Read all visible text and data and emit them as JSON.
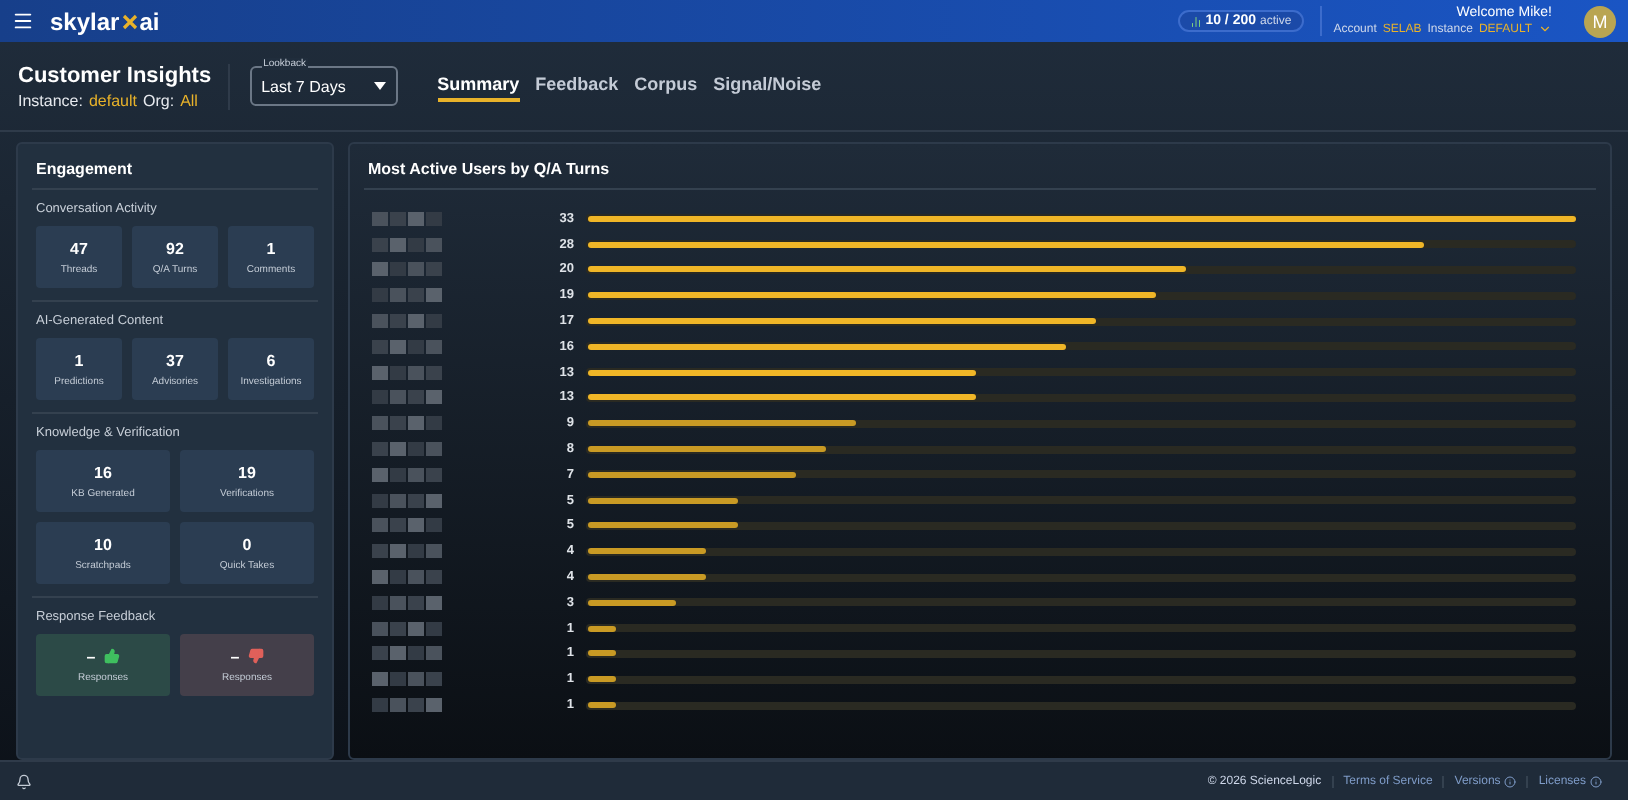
{
  "header": {
    "logo": "skylar",
    "logo_suffix": "ai",
    "usage": "10 / 200",
    "usage_label": "active",
    "welcome": "Welcome Mike!",
    "account_label": "Account",
    "account": "SELAB",
    "instance_label": "Instance",
    "instance": "DEFAULT",
    "avatar": "M"
  },
  "page": {
    "title": "Customer Insights",
    "instance_label": "Instance:",
    "instance": "default",
    "org_label": "Org:",
    "org": "All",
    "lookback_label": "Lookback",
    "lookback": "Last 7 Days",
    "tabs": [
      {
        "label": "Summary",
        "selected": true
      },
      {
        "label": "Feedback",
        "selected": false
      },
      {
        "label": "Corpus",
        "selected": false
      },
      {
        "label": "Signal/Noise",
        "selected": false
      }
    ]
  },
  "engagement": {
    "title": "Engagement",
    "sections": [
      {
        "title": "Conversation Activity",
        "stats": [
          {
            "value": "47",
            "label": "Threads"
          },
          {
            "value": "92",
            "label": "Q/A Turns"
          },
          {
            "value": "1",
            "label": "Comments"
          }
        ]
      },
      {
        "title": "AI-Generated Content",
        "stats": [
          {
            "value": "1",
            "label": "Predictions"
          },
          {
            "value": "37",
            "label": "Advisories"
          },
          {
            "value": "6",
            "label": "Investigations"
          }
        ]
      },
      {
        "title": "Knowledge & Verification",
        "stats": [
          {
            "value": "16",
            "label": "KB Generated"
          },
          {
            "value": "19",
            "label": "Verifications"
          },
          {
            "value": "10",
            "label": "Scratchpads"
          },
          {
            "value": "0",
            "label": "Quick Takes"
          }
        ]
      },
      {
        "title": "Response Feedback",
        "stats": [
          {
            "kind": "positive",
            "value": "–",
            "label": "Responses"
          },
          {
            "kind": "negative",
            "value": "–",
            "label": "Responses"
          }
        ]
      }
    ]
  },
  "chart_panel": {
    "title": "Most Active Users by Q/A Turns",
    "rows": [
      {
        "count": "33",
        "level": 1.0
      },
      {
        "count": "28",
        "level": 0.848
      },
      {
        "count": "20",
        "level": 0.606
      },
      {
        "count": "19",
        "level": 0.576
      },
      {
        "count": "17",
        "level": 0.515
      },
      {
        "count": "16",
        "level": 0.485
      },
      {
        "count": "13",
        "level": 0.394
      },
      {
        "count": "13",
        "level": 0.394
      },
      {
        "count": "9",
        "level": 0.273
      },
      {
        "count": "8",
        "level": 0.242
      },
      {
        "count": "7",
        "level": 0.212
      },
      {
        "count": "5",
        "level": 0.152
      },
      {
        "count": "5",
        "level": 0.152
      },
      {
        "count": "4",
        "level": 0.121
      },
      {
        "count": "4",
        "level": 0.121
      },
      {
        "count": "3",
        "level": 0.091
      },
      {
        "count": "1",
        "level": 0.03
      },
      {
        "count": "1",
        "level": 0.03
      },
      {
        "count": "1",
        "level": 0.03
      },
      {
        "count": "1",
        "level": 0.03
      }
    ]
  },
  "footer": {
    "copyright": "© 2026 ScienceLogic",
    "links": [
      {
        "label": "Terms of Service",
        "info": false
      },
      {
        "label": "Versions",
        "info": true
      },
      {
        "label": "Licenses",
        "info": true
      }
    ]
  }
}
